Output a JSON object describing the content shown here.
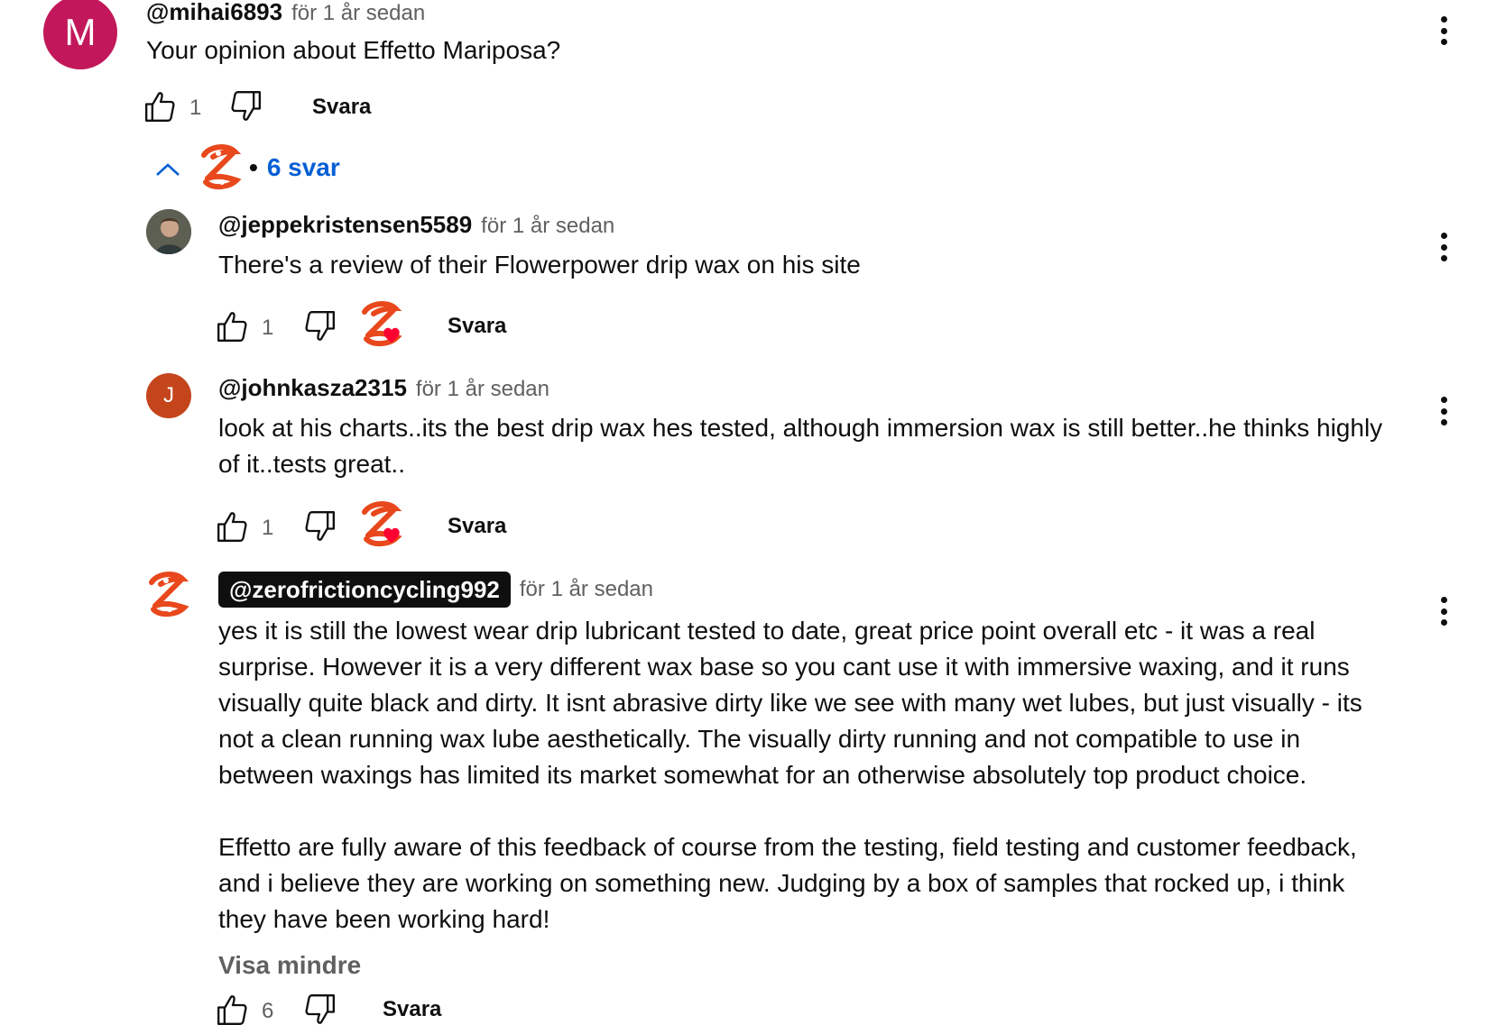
{
  "top_comment": {
    "avatar_letter": "M",
    "avatar_color": "#c2185b",
    "handle": "@mihai6893",
    "time": "för 1 år sedan",
    "text": "Your opinion about  Effetto Mariposa?",
    "likes": "1",
    "reply_label": "Svara"
  },
  "replies_toggle": {
    "bullet": "•",
    "label": "6 svar"
  },
  "replies": [
    {
      "handle": "@jeppekristensen5589",
      "time": "för 1 år sedan",
      "text": "There's a review of their Flowerpower drip wax on his site",
      "likes": "1",
      "reply_label": "Svara"
    },
    {
      "avatar_letter": "J",
      "avatar_color": "#c4451c",
      "handle": "@johnkasza2315",
      "time": "för 1 år sedan",
      "text_line1": "look at his charts..its the best drip wax hes tested, although immersion wax is still better..he thinks highly",
      "text_line2": "of it..tests great..",
      "likes": "1",
      "reply_label": "Svara"
    },
    {
      "handle": "@zerofrictioncycling992",
      "time": "för 1 år sedan",
      "paragraph1": [
        "yes it is still the lowest wear drip lubricant tested to date, great price point overall etc - it was a real",
        "surprise. However it is a very different wax base  so you cant use it with immersive waxing, and it runs",
        "visually quite black and dirty. It isnt abrasive dirty like we see with many wet lubes, but just visually - its",
        "not a clean running wax lube aesthetically. The visually dirty running and not compatible to use in",
        "between waxings has limited its market somewhat for an otherwise absolutely top product choice."
      ],
      "paragraph2": [
        "Effetto are fully aware of this feedback of course from the testing, field testing and customer feedback,",
        "and i believe they are working on something new. Judging by a box of samples that rocked up, i think",
        "they have been working hard!"
      ],
      "show_less": "Visa mindre",
      "likes": "6",
      "reply_label": "Svara"
    }
  ],
  "colors": {
    "link_blue": "#065fd4",
    "creator_orange": "#e8481c",
    "heart_red": "#ff0033"
  }
}
